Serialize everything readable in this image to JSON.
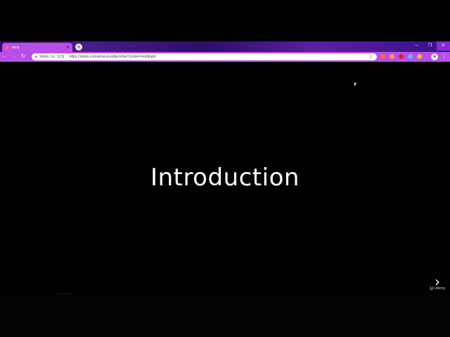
{
  "browser": {
    "tab": {
      "title": "deck"
    },
    "new_tab_label": "+",
    "window_controls": {
      "minimize": "─",
      "restore": "❐",
      "close": "✕"
    },
    "toolbar": {
      "back": "←",
      "forward": "→",
      "reload": "↻",
      "site_identity": "Slides, Inc. [US]",
      "url": "https://slides.com/what-snot/deck/live?context=editing#/",
      "star": "☆",
      "menu": "⋮"
    },
    "extensions": [
      {
        "icon": "extension-icon",
        "color": "#ff6a3d"
      },
      {
        "icon": "extension-icon",
        "color": "#ff9a3d"
      },
      {
        "icon": "extension-icon",
        "color": "#d62020"
      },
      {
        "icon": "extension-icon",
        "color": "#6ab0ff"
      },
      {
        "icon": "extension-icon",
        "color": "#ffb347"
      }
    ]
  },
  "slide": {
    "title": "Introduction",
    "next_arrow": "›"
  },
  "watermark": {
    "glyph": "u",
    "text": "Udemy"
  }
}
